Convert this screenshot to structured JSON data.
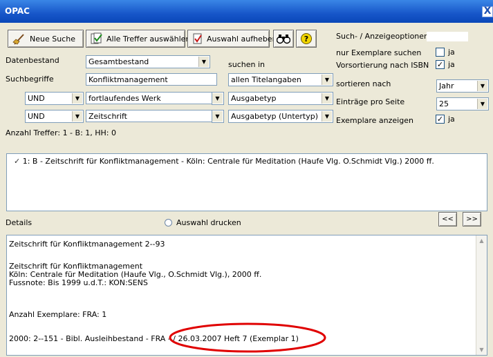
{
  "window": {
    "title": "OPAC",
    "close_glyph": "X"
  },
  "toolbar": {
    "new_search": "Neue Suche",
    "select_all": "Alle Treffer auswählen",
    "clear_selection": "Auswahl aufheben",
    "binoculars_icon": "binoculars-icon",
    "help_icon": "help-icon"
  },
  "form": {
    "datenbestand_label": "Datenbestand",
    "datenbestand_value": "Gesamtbestand",
    "suchbegriffe_label": "Suchbegriffe",
    "suchbegriff_1": "Konfliktmanagement",
    "op_2": "UND",
    "suchbegriff_2": "fortlaufendes Werk",
    "op_3": "UND",
    "suchbegriff_3": "Zeitschrift",
    "suchen_in_label": "suchen in",
    "field_1": "allen Titelangaben",
    "field_2": "Ausgabetyp",
    "field_3": "Ausgabetyp (Untertyp)",
    "anzahl_treffer": "Anzahl Treffer: 1 - B: 1, HH: 0"
  },
  "options": {
    "header": "Such- / Anzeigeoptionen",
    "nur_exemplare_label": "nur Exemplare suchen",
    "nur_exemplare_checked": false,
    "vorsortierung_label": "Vorsortierung nach ISBN",
    "vorsortierung_checked": true,
    "sortieren_label": "sortieren nach",
    "sortieren_value": "Jahr",
    "eintraege_label": "Einträge pro Seite",
    "eintraege_value": "25",
    "exemplare_label": "Exemplare anzeigen",
    "exemplare_checked": true,
    "ja": "ja"
  },
  "results": [
    "1: B - Zeitschrift für Konfliktmanagement - Köln: Centrale für Meditation (Haufe Vlg. O.Schmidt Vlg.) 2000 ff."
  ],
  "details": {
    "label": "Details",
    "print_label": "Auswahl drucken",
    "prev": "<<",
    "next": ">>",
    "lines": [
      "Zeitschrift für Konfliktmanagement        2--93",
      "Zeitschrift für Konfliktmanagement",
      "Köln: Centrale für Meditation (Haufe Vlg., O.Schmidt Vlg.), 2000 ff.",
      "Fussnote: Bis 1999 u.d.T.: KON:SENS",
      "Anzahl Exemplare:  FRA: 1",
      "2000: 2--151 - Bibl. Ausleihbestand - FRA - / 26.03.2007 Heft 7 (Exemplar 1)"
    ],
    "highlight_color": "#e00000"
  }
}
